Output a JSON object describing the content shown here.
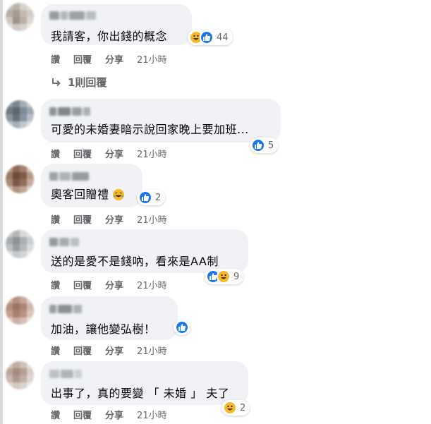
{
  "comments": [
    {
      "text": "我請客，你出錢的概念",
      "reactions": [
        "haha",
        "like"
      ],
      "count": "44"
    },
    {
      "text": "可愛的未婚妻暗示說回家晚上要加班...",
      "reactions": [
        "like"
      ],
      "count": "5"
    },
    {
      "text": "奧客回贈禮",
      "reactions": [
        "like"
      ],
      "count": "2"
    },
    {
      "text": "送的是愛不是錢吶，看來是AA制",
      "reactions": [
        "like",
        "haha"
      ],
      "count": "9"
    },
    {
      "text": "加油，讓他變弘樹！",
      "reactions": [
        "like"
      ],
      "count": ""
    },
    {
      "text": "出事了，真的要變 「 未婚 」 夫了",
      "reactions": [
        "haha"
      ],
      "count": "2"
    }
  ],
  "actions": {
    "like": "讚",
    "reply": "回覆",
    "share": "分享",
    "time": "21小時"
  },
  "view_replies": "1則回覆",
  "colors": {
    "bubble": "#f0f2f5",
    "like": "#1877f2",
    "haha": "#f7b928",
    "meta": "#65676b"
  }
}
